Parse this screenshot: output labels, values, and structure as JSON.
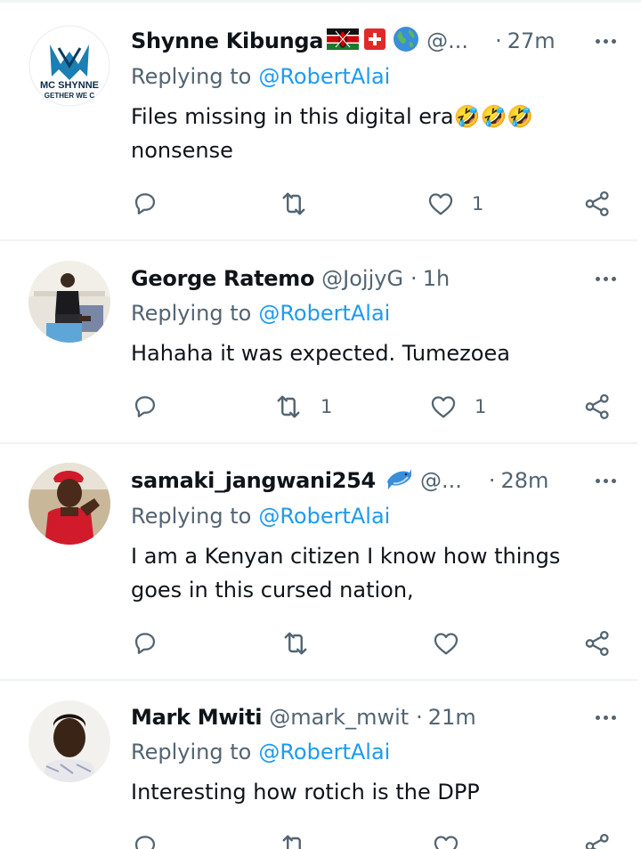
{
  "replying_to_label": "Replying to",
  "tweets": [
    {
      "name": "Shynne Kibunga",
      "handle": "@...",
      "time": "27m",
      "mention": "@RobertAlai",
      "body_lines": [
        "Files missing in this digital era🤣🤣🤣",
        "nonsense"
      ],
      "reply_count": "",
      "retweet_count": "",
      "like_count": "1",
      "avatar_text": [
        "MC SHYNNE",
        "GETHER WE C"
      ]
    },
    {
      "name": "George Ratemo",
      "handle": "@JojjyG",
      "time": "1h",
      "mention": "@RobertAlai",
      "body_lines": [
        "Hahaha it was expected. Tumezoea"
      ],
      "reply_count": "",
      "retweet_count": "1",
      "like_count": "1"
    },
    {
      "name": "samaki_jangwani254",
      "handle": "@...",
      "time": "28m",
      "mention": "@RobertAlai",
      "body_lines": [
        "I am a  Kenyan citizen I know how things",
        "goes in this cursed nation,"
      ],
      "reply_count": "",
      "retweet_count": "",
      "like_count": ""
    },
    {
      "name": "Mark Mwiti",
      "handle": "@mark_mwit",
      "time": "21m",
      "mention": "@RobertAlai",
      "body_lines": [
        "Interesting how rotich is the DPP"
      ],
      "reply_count": "",
      "retweet_count": "",
      "like_count": ""
    }
  ],
  "colors": {
    "text_primary": "#0f1419",
    "text_secondary": "#536471",
    "link": "#1d9bf0",
    "divider": "#eff3f4"
  },
  "icons": {
    "reply": "reply-icon",
    "retweet": "retweet-icon",
    "like": "heart-icon",
    "share": "share-icon",
    "more": "more-icon"
  }
}
